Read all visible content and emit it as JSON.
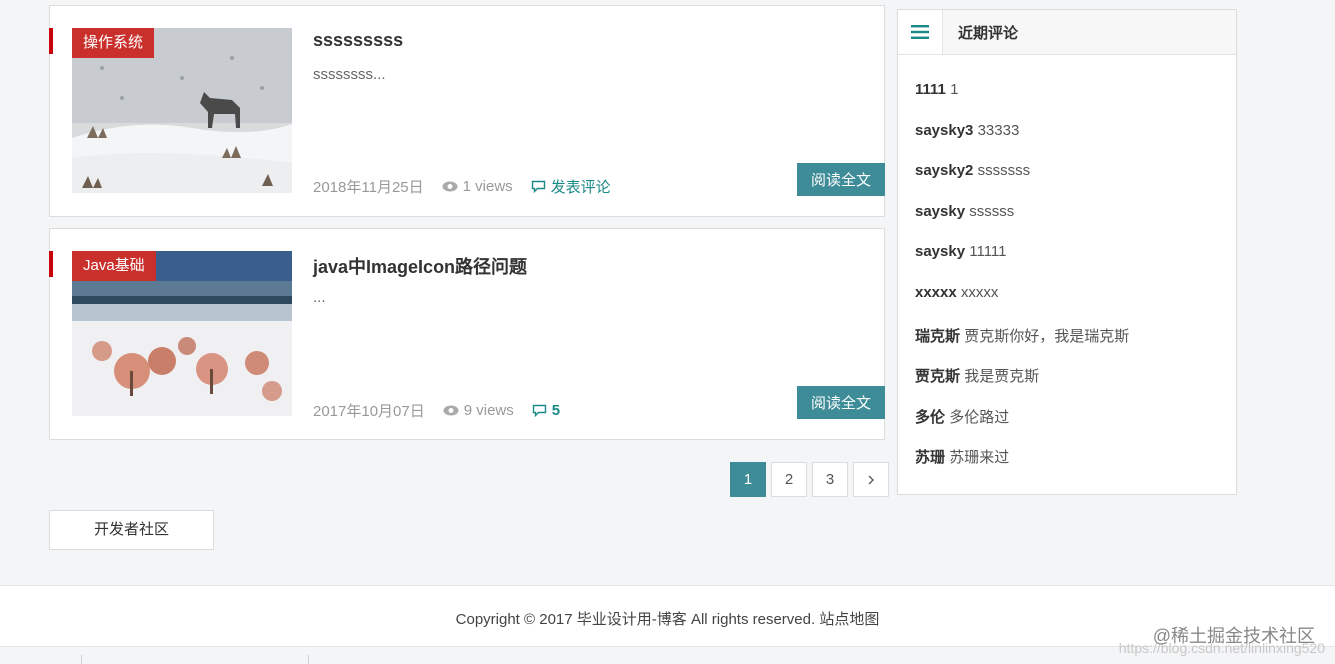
{
  "posts": [
    {
      "category": "操作系统",
      "title": "sssssssss",
      "excerpt": "ssssssss...",
      "date": "2018年11月25日",
      "views": "1 views",
      "comments": "发表评论",
      "read_more": "阅读全文"
    },
    {
      "category": "Java基础",
      "title": "java中ImageIcon路径问题",
      "excerpt": "...",
      "date": "2017年10月07日",
      "views": "9 views",
      "comments": "5",
      "read_more": "阅读全文"
    }
  ],
  "pagination": {
    "pages": [
      "1",
      "2",
      "3"
    ],
    "current": "1",
    "next": "›"
  },
  "developer_box": "开发者社区",
  "sidebar": {
    "title": "近期评论",
    "comments": [
      {
        "author": "1111",
        "text": "1"
      },
      {
        "author": "saysky3",
        "text": "33333"
      },
      {
        "author": "saysky2",
        "text": "sssssss"
      },
      {
        "author": "saysky",
        "text": "ssssss"
      },
      {
        "author": "saysky",
        "text": "11111"
      },
      {
        "author": "xxxxx",
        "text": "xxxxx"
      },
      {
        "author": "瑞克斯",
        "text": "贾克斯你好，我是瑞克斯"
      },
      {
        "author": "贾克斯",
        "text": "我是贾克斯"
      },
      {
        "author": "多伦",
        "text": "多伦路过"
      },
      {
        "author": "苏珊",
        "text": "苏珊来过"
      }
    ]
  },
  "footer": {
    "copyright": "Copyright © 2017 毕业设计用-博客 All rights reserved. 站点地图"
  },
  "watermark": {
    "text": "@稀土掘金技术社区",
    "url": "https://blog.csdn.net/linlinxing520"
  },
  "colors": {
    "accent": "#3d8c98",
    "category": "#c9302c",
    "comment_link": "#1a8a88"
  }
}
